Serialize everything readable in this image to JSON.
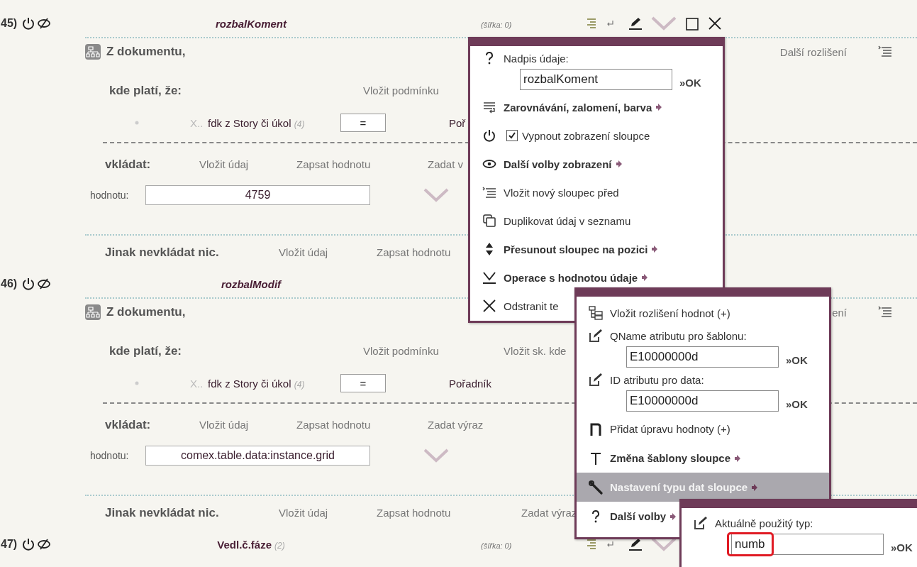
{
  "rows": [
    {
      "number": "45)",
      "title": "rozbalKoment",
      "display_off": true,
      "width_label": "(šířka: 0)",
      "source": {
        "label": "Z dokumentu,",
        "more": "Další rozlišení"
      },
      "condition": {
        "heading": "kde platí, že:",
        "actions": [
          "Vložit podmínku"
        ],
        "remove": "X..",
        "field": "fdk z Story či úkol",
        "count": "(4)",
        "operator": "=",
        "value": "Poř"
      },
      "insert": {
        "heading": "vkládat:",
        "actions": [
          "Vložit údaj",
          "Zapsat hodnotu",
          "Zadat v"
        ],
        "label": "hodnotu:",
        "value": "4759"
      },
      "otherwise": {
        "text": "Jinak nevkládat nic.",
        "actions": [
          "Vložit údaj",
          "Zapsat hodnotu"
        ]
      }
    },
    {
      "number": "46)",
      "title": "rozbalModif",
      "display_off": true,
      "source": {
        "label": "Z dokumentu,",
        "more": "ení"
      },
      "condition": {
        "heading": "kde platí, že:",
        "actions": [
          "Vložit podmínku",
          "Vložit sk. kde"
        ],
        "remove": "X..",
        "field": "fdk z Story či úkol",
        "count": "(4)",
        "operator": "=",
        "value": "Pořadník"
      },
      "insert": {
        "heading": "vkládat:",
        "actions": [
          "Vložit údaj",
          "Zapsat hodnotu",
          "Zadat výraz"
        ],
        "label": "hodnotu:",
        "value": "comex.table.data:instance.grid"
      },
      "otherwise": {
        "text": "Jinak nevkládat nic.",
        "actions": [
          "Vložit údaj",
          "Zapsat hodnotu",
          "Zadat výraz"
        ]
      }
    },
    {
      "number": "47)",
      "title": "Vedl.č.fáze",
      "count": "(2)",
      "display_off": false,
      "width_label": "(šířka: 0)"
    }
  ],
  "menus": [
    {
      "items": [
        {
          "kind": "field",
          "label": "Nadpis údaje:",
          "value": "rozbalKoment",
          "ok": "»OK"
        },
        {
          "kind": "submenu",
          "label": "Zarovnávání, zalomení, barva"
        },
        {
          "kind": "checkbox",
          "label": "Vypnout zobrazení sloupce",
          "checked": true
        },
        {
          "kind": "submenu",
          "label": "Další volby zobrazení"
        },
        {
          "kind": "action",
          "label": "Vložit nový sloupec před"
        },
        {
          "kind": "action",
          "label": "Duplikovat údaj v seznamu"
        },
        {
          "kind": "submenu",
          "label": "Přesunout sloupec na pozici"
        },
        {
          "kind": "submenu",
          "label": "Operace s hodnotou údaje"
        },
        {
          "kind": "action",
          "label": "Odstranit te"
        }
      ]
    },
    {
      "items": [
        {
          "kind": "action",
          "label": "Vložit rozlišení hodnot (+)",
          "selected": false
        },
        {
          "kind": "field",
          "label": "QName atributu pro šablonu:",
          "value": "E10000000d",
          "ok": "»OK",
          "selected": false
        },
        {
          "kind": "field",
          "label": "ID atributu pro data:",
          "value": "E10000000d",
          "ok": "»OK",
          "selected": false
        },
        {
          "kind": "action",
          "label": "Přidat úpravu hodnoty (+)",
          "selected": false
        },
        {
          "kind": "submenu",
          "label": "Změna šablony sloupce",
          "selected": false
        },
        {
          "kind": "submenu",
          "label": "Nastavení typu dat sloupce",
          "selected": true
        },
        {
          "kind": "submenu",
          "label": "Další volby",
          "selected": false
        }
      ]
    },
    {
      "items": [
        {
          "kind": "field",
          "label": "Aktuálně použitý typ:",
          "value": "numb",
          "ok": "»OK",
          "highlighted": true
        }
      ]
    }
  ]
}
